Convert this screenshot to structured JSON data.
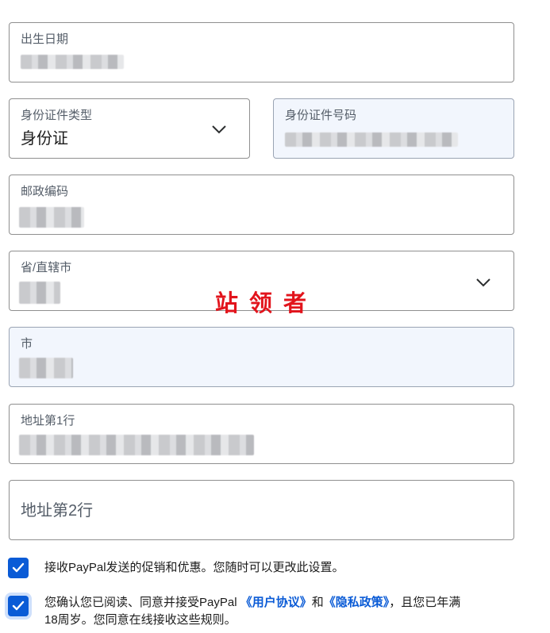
{
  "form": {
    "birth_date": {
      "label": "出生日期"
    },
    "id_type": {
      "label": "身份证件类型",
      "value": "身份证"
    },
    "id_number": {
      "label": "身份证件号码"
    },
    "postal_code": {
      "label": "邮政编码"
    },
    "province": {
      "label": "省/直辖市"
    },
    "city": {
      "label": "市"
    },
    "address1": {
      "label": "地址第1行"
    },
    "address2": {
      "placeholder": "地址第2行"
    }
  },
  "watermark": "站领者",
  "consents": {
    "promo": {
      "checked": true,
      "text": "接收PayPal发送的促销和优惠。您随时可以更改此设置。"
    },
    "agreement": {
      "checked": true,
      "text_before": "您确认您已阅读、同意并接受PayPal",
      "user_agreement_link": "《用户协议》",
      "text_and": "和",
      "privacy_link": "《隐私政策》",
      "text_after": "，且您已年满",
      "text_line2": "18周岁。您同意在线接收这些规则。"
    }
  },
  "colors": {
    "accent": "#0a5bd6",
    "border": "#8f8f8f",
    "shaded_bg": "#f2f6fd",
    "watermark": "#e2141c"
  },
  "icons": {
    "dropdown": "chevron-down-icon",
    "checkbox": "check-icon"
  }
}
